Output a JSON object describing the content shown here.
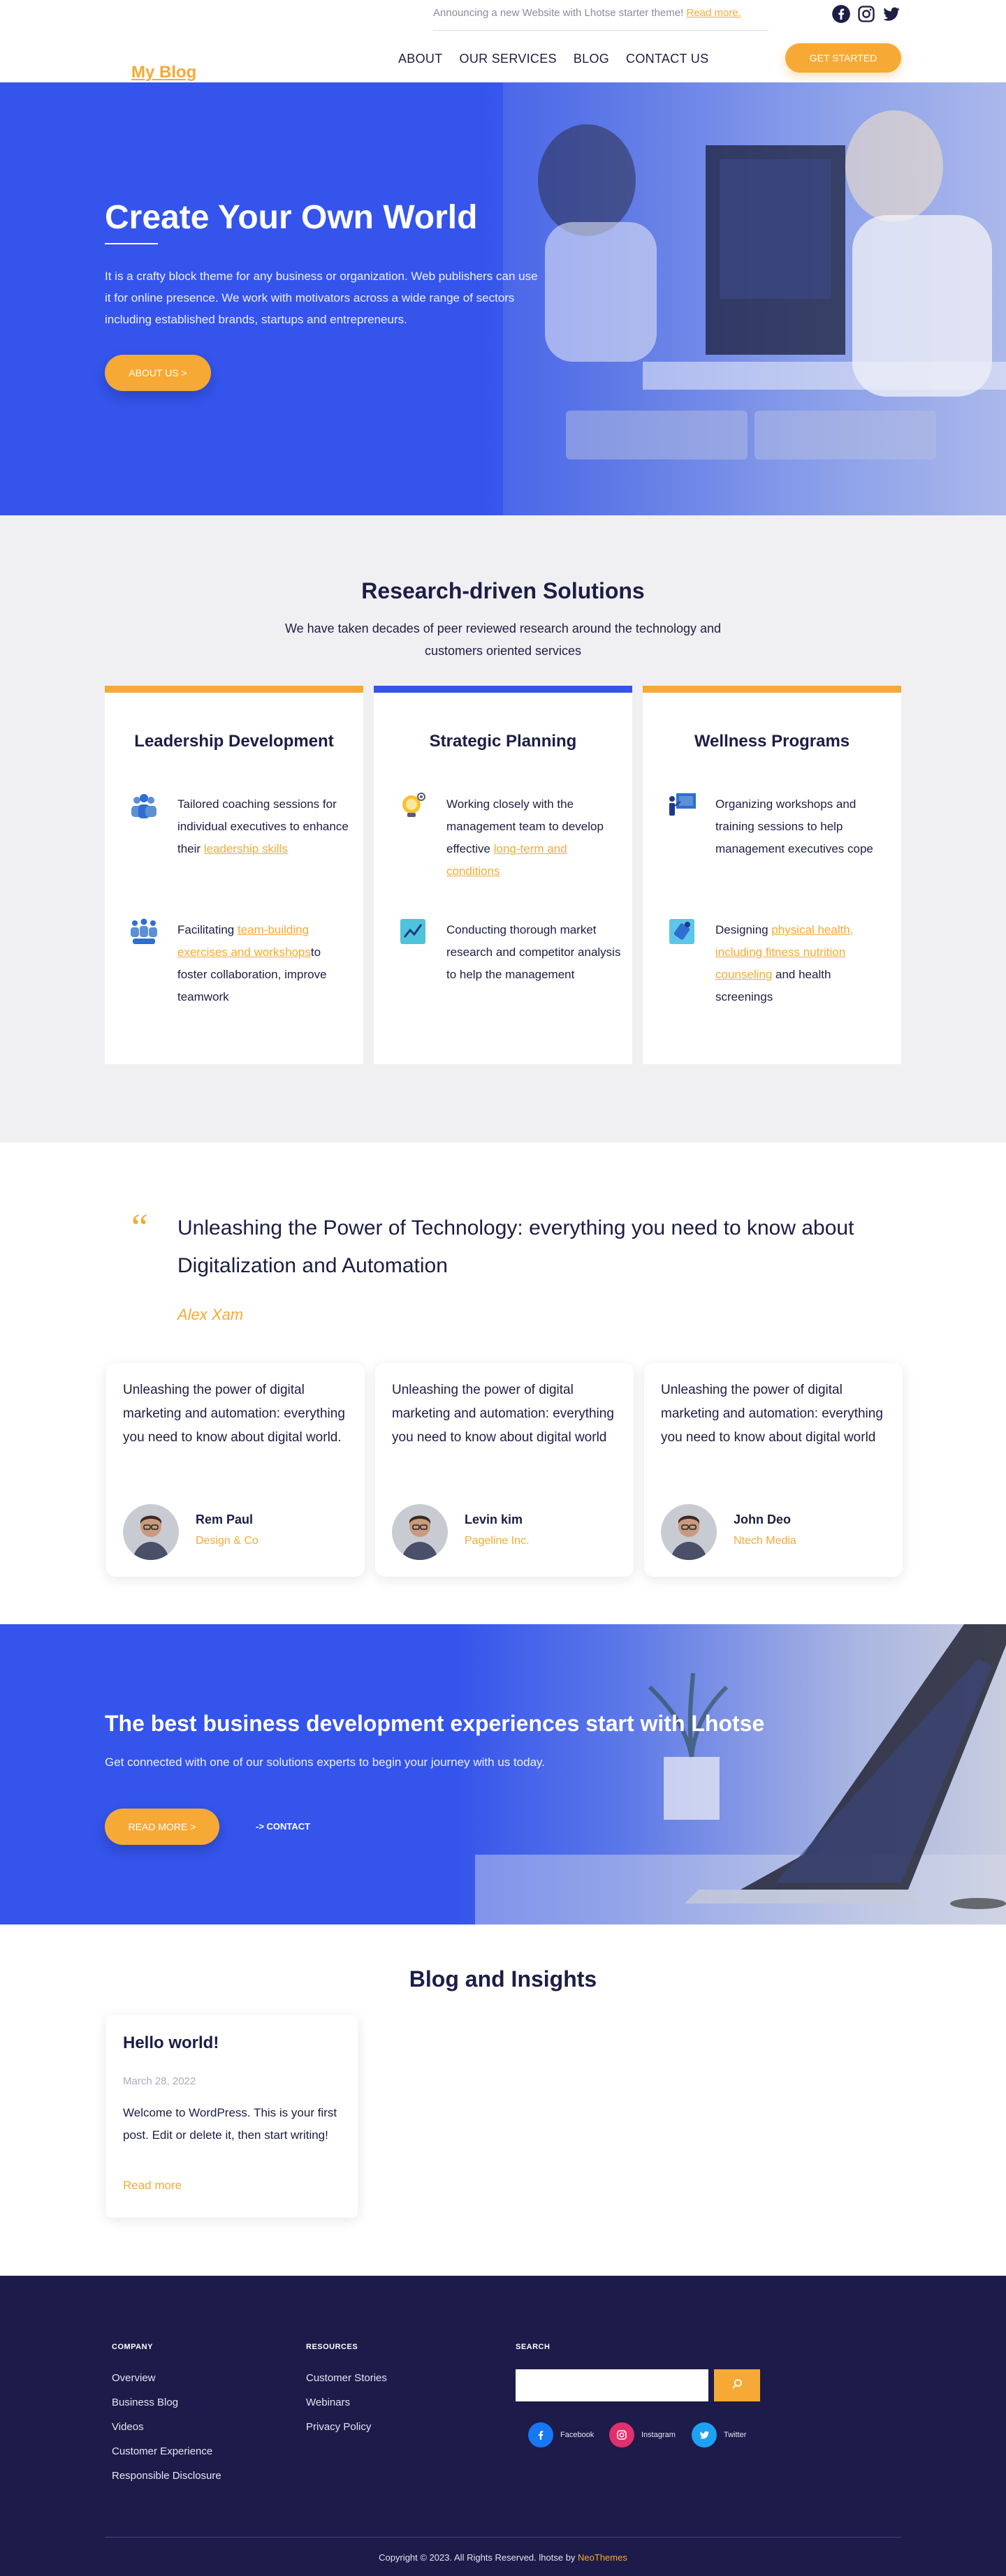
{
  "header": {
    "announcement_text": "Announcing a new Website with Lhotse starter theme! ",
    "announcement_link": "Read more.",
    "logo": "My Blog",
    "nav": [
      "ABOUT",
      "OUR SERVICES",
      "BLOG",
      "CONTACT US"
    ],
    "cta": "GET STARTED",
    "social_icons": [
      "facebook-icon",
      "instagram-icon",
      "twitter-icon"
    ]
  },
  "hero": {
    "title": "Create Your Own World",
    "text": "It is a crafty block theme for any business or organization. Web publishers can use it for online presence. We work with motivators across a wide range of sectors including established brands, startups and entrepreneurs.",
    "button": "ABOUT US >"
  },
  "solutions": {
    "title": "Research-driven Solutions",
    "subtitle": "We have taken decades of peer reviewed research around the technology and customers oriented services",
    "cards": [
      {
        "title": "Leadership Development",
        "features": [
          {
            "icon": "team-icon",
            "text": "Tailored coaching sessions for individual executives to enhance their ",
            "link": "leadership skills",
            "after": ""
          },
          {
            "icon": "group-icon",
            "text": "Facilitating ",
            "link": "team-building exercises and workshops",
            "after": "to foster collaboration, improve teamwork"
          }
        ]
      },
      {
        "title": "Strategic Planning",
        "features": [
          {
            "icon": "lightbulb-icon",
            "text": "Working closely with the management team to develop effective ",
            "link": "long-term and conditions",
            "after": ""
          },
          {
            "icon": "chart-icon",
            "text": "Conducting thorough market research and competitor analysis to help the management",
            "link": "",
            "after": ""
          }
        ]
      },
      {
        "title": "Wellness Programs",
        "features": [
          {
            "icon": "presentation-icon",
            "text": "Organizing workshops and training sessions to help management executives cope",
            "link": "",
            "after": ""
          },
          {
            "icon": "health-icon",
            "text": "Designing ",
            "link": "physical health, including fitness nutrition counseling",
            "after": " and health screenings"
          }
        ]
      }
    ]
  },
  "testimonials": {
    "quote": "Unleashing the Power of Technology: everything you need to know about Digitalization and Automation",
    "author": "Alex Xam",
    "items": [
      {
        "text": "Unleashing the power of digital marketing and automation: everything you need to know about digital world.",
        "name": "Rem Paul",
        "company": "Design & Co"
      },
      {
        "text": "Unleashing the power of digital marketing and automation: everything you need to know about digital world",
        "name": "Levin kim",
        "company": "Pageline Inc."
      },
      {
        "text": "Unleashing the power of digital marketing and automation: everything you need to know about digital world",
        "name": "John Deo",
        "company": "Ntech Media"
      }
    ]
  },
  "cta": {
    "title": "The best business development experiences start with Lhotse",
    "text": "Get connected with one of our solutions experts to begin your journey with us today.",
    "primary": "READ MORE >",
    "secondary": "-> CONTACT"
  },
  "blog": {
    "title": "Blog and Insights",
    "post": {
      "title": "Hello world!",
      "date": "March 28, 2022",
      "excerpt": "Welcome to WordPress. This is your first post. Edit or delete it, then start writing!",
      "more": "Read more"
    }
  },
  "footer": {
    "company": {
      "heading": "COMPANY",
      "links": [
        "Overview",
        "Business Blog",
        "Videos",
        "Customer Experience",
        "Responsible Disclosure"
      ]
    },
    "resources": {
      "heading": "RESOURCES",
      "links": [
        "Customer Stories",
        "Webinars",
        "Privacy Policy"
      ]
    },
    "search": {
      "heading": "SEARCH",
      "placeholder": "",
      "button_icon": "search-icon"
    },
    "socials": [
      {
        "label": "Facebook",
        "color": "#1877f2"
      },
      {
        "label": "Instagram",
        "color": "#e1306c"
      },
      {
        "label": "Twitter",
        "color": "#1da1f2"
      }
    ],
    "copyright": "Copyright © 2023. All Rights Reserved. lhotse by ",
    "copyright_link": "NeoThemes"
  },
  "colors": {
    "accent": "#f6a935",
    "primary": "#3454ec",
    "dark": "#1d1b4a",
    "text": "#1d1d45"
  }
}
